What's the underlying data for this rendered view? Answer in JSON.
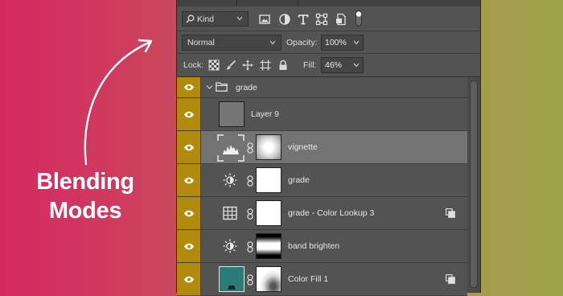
{
  "promo": {
    "line1": "Blending",
    "line2": "Modes"
  },
  "filter_bar": {
    "kind_label": "Kind",
    "icons": [
      "search-icon",
      "image-filter-icon",
      "adjustment-filter-icon",
      "type-filter-icon",
      "shape-filter-icon",
      "smart-object-filter-icon",
      "filter-toggle"
    ]
  },
  "blend": {
    "mode": "Normal",
    "opacity_label": "Opacity:",
    "opacity_value": "100%"
  },
  "lock": {
    "label": "Lock:",
    "icons": [
      "lock-transparent-icon",
      "lock-paint-icon",
      "lock-position-icon",
      "lock-artboard-icon",
      "lock-all-icon"
    ],
    "fill_label": "Fill:",
    "fill_value": "46%"
  },
  "layers": [
    {
      "name": "grade",
      "type": "group",
      "expanded": true
    },
    {
      "name": "Layer 9",
      "type": "pixel"
    },
    {
      "name": "vignette",
      "type": "levels-adjustment",
      "selected": true
    },
    {
      "name": "grade",
      "type": "brightness-adjustment"
    },
    {
      "name": "grade - Color Lookup 3",
      "type": "color-lookup-adjustment",
      "clipped": true
    },
    {
      "name": "band brighten",
      "type": "brightness-adjustment"
    },
    {
      "name": "Color Fill 1",
      "type": "fill",
      "clipped": true
    }
  ],
  "colors": {
    "panel_bg": "#535353",
    "visibility_column": "#b18b0d",
    "selected_row": "#737373",
    "color_fill_swatch": "#2a7a78"
  }
}
